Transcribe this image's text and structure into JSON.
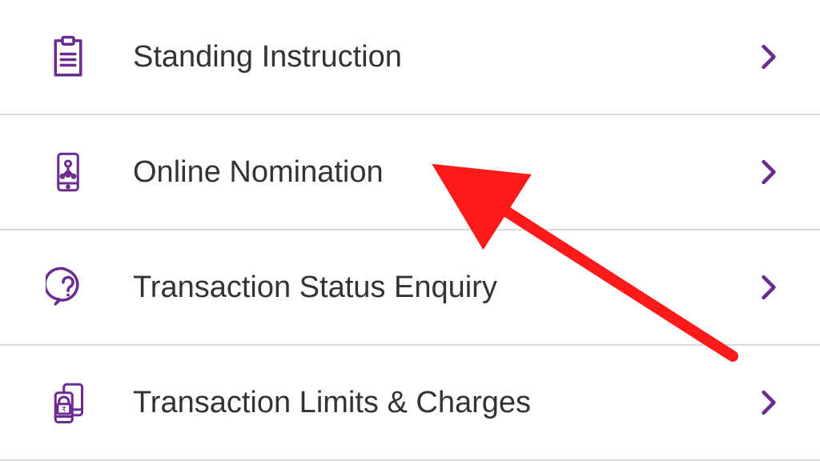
{
  "colors": {
    "accent": "#6a2c91",
    "arrow": "#ff1a1a"
  },
  "menu": {
    "items": [
      {
        "label": "Standing Instruction"
      },
      {
        "label": "Online Nomination"
      },
      {
        "label": "Transaction Status Enquiry"
      },
      {
        "label": "Transaction Limits & Charges"
      }
    ]
  }
}
